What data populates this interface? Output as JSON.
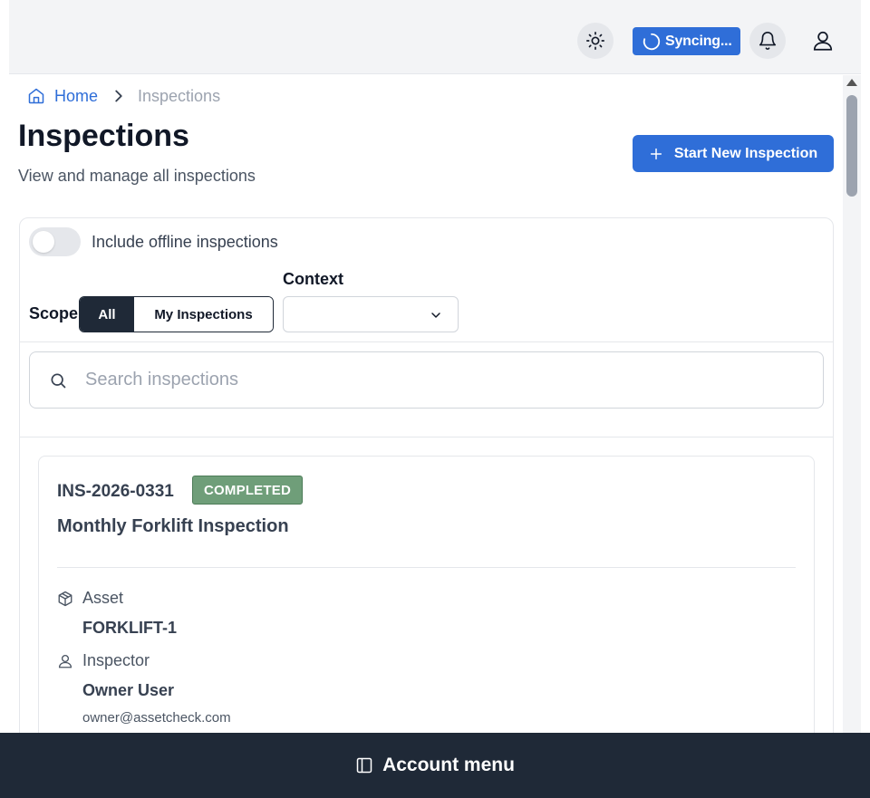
{
  "header": {
    "sync_label": "Syncing..."
  },
  "breadcrumb": {
    "home": "Home",
    "current": "Inspections"
  },
  "page": {
    "title": "Inspections",
    "subtitle": "View and manage all inspections",
    "start_button": "Start New Inspection"
  },
  "filters": {
    "offline_toggle_label": "Include offline inspections",
    "offline_toggle_on": false,
    "scope_label": "Scope",
    "scope_options": [
      "All",
      "My Inspections"
    ],
    "scope_selected": "All",
    "context_label": "Context",
    "context_value": ""
  },
  "search": {
    "placeholder": "Search inspections"
  },
  "inspections": [
    {
      "id": "INS-2026-0331",
      "status": "COMPLETED",
      "title": "Monthly Forklift Inspection",
      "asset_label": "Asset",
      "asset_value": "FORKLIFT-1",
      "inspector_label": "Inspector",
      "inspector_name": "Owner User",
      "inspector_email": "owner@assetcheck.com"
    }
  ],
  "footer": {
    "account_menu": "Account menu"
  },
  "colors": {
    "primary": "#2f6ed8",
    "status_completed": "#6f9e79",
    "dark": "#1f2937"
  },
  "icons": [
    "sun-icon",
    "spinner-icon",
    "bell-icon",
    "user-icon",
    "home-icon",
    "chevron-right-icon",
    "plus-icon",
    "chevron-down-icon",
    "search-icon",
    "box-icon",
    "user-icon",
    "sidebar-icon"
  ]
}
